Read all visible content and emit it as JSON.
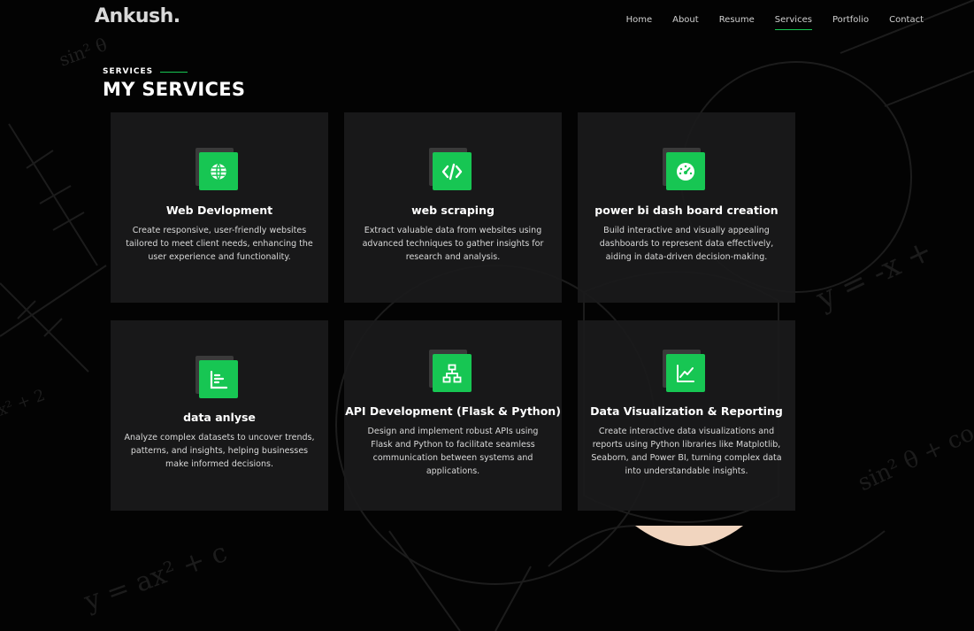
{
  "header": {
    "logo": "Ankush.",
    "nav": [
      "Home",
      "About",
      "Resume",
      "Services",
      "Portfolio",
      "Contact"
    ],
    "active_nav": "Services"
  },
  "section": {
    "eyebrow": "SERVICES",
    "title": "MY SERVICES"
  },
  "services": [
    {
      "title": "Web Devlopment",
      "description": "Create responsive, user-friendly websites tailored to meet client needs, enhancing the user experience and functionality.",
      "icon": "globe-icon"
    },
    {
      "title": "web scraping",
      "description": "Extract valuable data from websites using advanced techniques to gather insights for research and analysis.",
      "icon": "code-icon"
    },
    {
      "title": "power bi dash board creation",
      "description": "Build interactive and visually appealing dashboards to represent data effectively, aiding in data-driven decision-making.",
      "icon": "gauge-icon"
    },
    {
      "title": "data anlyse",
      "description": "Analyze complex datasets to uncover trends, patterns, and insights, helping businesses make informed decisions.",
      "icon": "bar-chart-icon"
    },
    {
      "title": "API Development (Flask & Python)",
      "description": "Design and implement robust APIs using Flask and Python to facilitate seamless communication between systems and applications.",
      "icon": "network-icon"
    },
    {
      "title": "Data Visualization & Reporting",
      "description": "Create interactive data visualizations and reports using Python libraries like Matplotlib, Seaborn, and Power BI, turning complex data into understandable insights.",
      "icon": "line-chart-icon"
    }
  ],
  "background": {
    "formulas": [
      "sin² θ",
      "y = ax² + c",
      "y = -x +",
      "sin² θ + co",
      "x² + 2"
    ]
  },
  "colors": {
    "accent": "#17c653",
    "background": "#030303",
    "card": "#1a1a1b"
  }
}
